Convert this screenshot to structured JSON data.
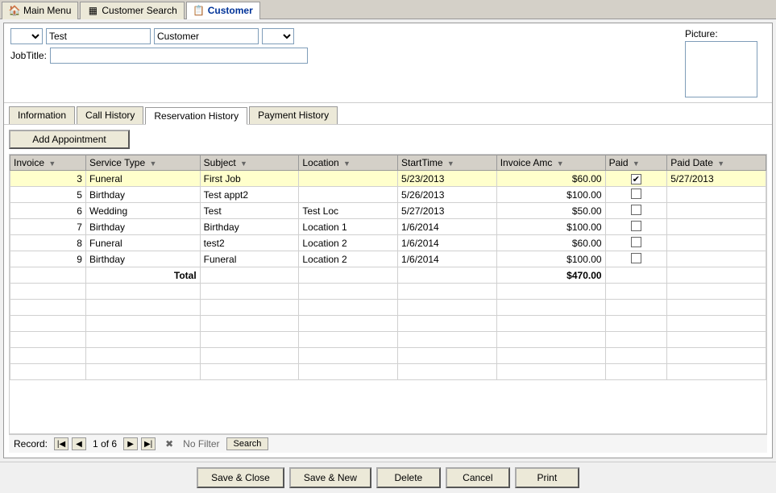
{
  "topTabs": [
    {
      "id": "main-menu",
      "label": "Main Menu",
      "icon": "home",
      "active": false
    },
    {
      "id": "customer-search",
      "label": "Customer Search",
      "icon": "search",
      "active": false
    },
    {
      "id": "customer",
      "label": "Customer",
      "icon": "person",
      "active": true
    }
  ],
  "form": {
    "salutation": "",
    "firstName": "Test",
    "lastName": "Customer",
    "suffix": "",
    "jobTitle": "",
    "jobTitleLabel": "JobTitle:",
    "pictureLabel": "Picture:"
  },
  "innerTabs": [
    {
      "id": "information",
      "label": "Information",
      "active": false
    },
    {
      "id": "call-history",
      "label": "Call History",
      "active": false
    },
    {
      "id": "reservation-history",
      "label": "Reservation History",
      "active": true
    },
    {
      "id": "payment-history",
      "label": "Payment History",
      "active": false
    }
  ],
  "addBtn": "Add Appointment",
  "tableHeaders": [
    {
      "id": "invoice",
      "label": "Invoice"
    },
    {
      "id": "service-type",
      "label": "Service Type"
    },
    {
      "id": "subject",
      "label": "Subject"
    },
    {
      "id": "location",
      "label": "Location"
    },
    {
      "id": "start-time",
      "label": "StartTime"
    },
    {
      "id": "invoice-amount",
      "label": "Invoice Amc"
    },
    {
      "id": "paid",
      "label": "Paid"
    },
    {
      "id": "paid-date",
      "label": "Paid Date"
    }
  ],
  "tableRows": [
    {
      "invoice": "3",
      "serviceType": "Funeral",
      "subject": "First Job",
      "location": "",
      "startTime": "5/23/2013",
      "invoiceAmount": "$60.00",
      "paid": true,
      "paidDate": "5/27/2013",
      "selected": true
    },
    {
      "invoice": "5",
      "serviceType": "Birthday",
      "subject": "Test appt2",
      "location": "",
      "startTime": "5/26/2013",
      "invoiceAmount": "$100.00",
      "paid": false,
      "paidDate": "",
      "selected": false
    },
    {
      "invoice": "6",
      "serviceType": "Wedding",
      "subject": "Test",
      "location": "Test Loc",
      "startTime": "5/27/2013",
      "invoiceAmount": "$50.00",
      "paid": false,
      "paidDate": "",
      "selected": false
    },
    {
      "invoice": "7",
      "serviceType": "Birthday",
      "subject": "Birthday",
      "location": "Location 1",
      "startTime": "1/6/2014",
      "invoiceAmount": "$100.00",
      "paid": false,
      "paidDate": "",
      "selected": false
    },
    {
      "invoice": "8",
      "serviceType": "Funeral",
      "subject": "test2",
      "location": "Location 2",
      "startTime": "1/6/2014",
      "invoiceAmount": "$60.00",
      "paid": false,
      "paidDate": "",
      "selected": false
    },
    {
      "invoice": "9",
      "serviceType": "Birthday",
      "subject": "Funeral",
      "location": "Location 2",
      "startTime": "1/6/2014",
      "invoiceAmount": "$100.00",
      "paid": false,
      "paidDate": "",
      "selected": false
    }
  ],
  "totalRow": {
    "label": "Total",
    "amount": "$470.00"
  },
  "navBar": {
    "recordLabel": "Record:",
    "currentRecord": "1",
    "totalRecords": "6",
    "filterLabel": "No Filter",
    "searchLabel": "Search"
  },
  "bottomButtons": [
    {
      "id": "save-close",
      "label": "Save & Close"
    },
    {
      "id": "save-new",
      "label": "Save & New"
    },
    {
      "id": "delete",
      "label": "Delete"
    },
    {
      "id": "cancel",
      "label": "Cancel"
    },
    {
      "id": "print",
      "label": "Print"
    }
  ]
}
